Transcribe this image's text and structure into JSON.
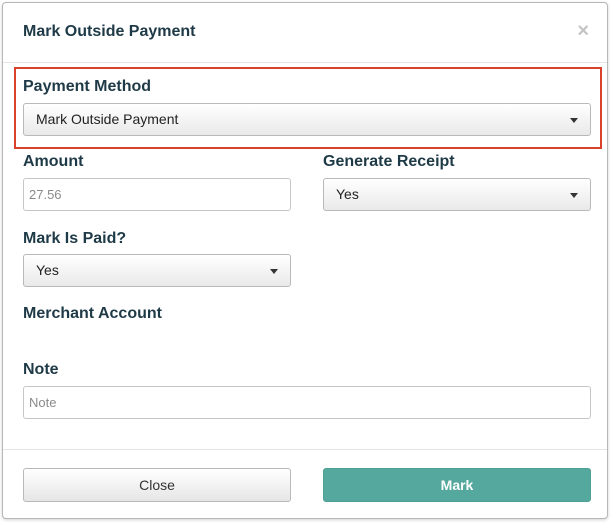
{
  "modal": {
    "title": "Mark Outside Payment",
    "close_icon": "×"
  },
  "payment_method": {
    "label": "Payment Method",
    "selected": "Mark Outside Payment"
  },
  "amount": {
    "label": "Amount",
    "value": "27.56"
  },
  "generate_receipt": {
    "label": "Generate Receipt",
    "selected": "Yes"
  },
  "mark_is_paid": {
    "label": "Mark Is Paid?",
    "selected": "Yes"
  },
  "merchant_account": {
    "label": "Merchant Account"
  },
  "note": {
    "label": "Note",
    "placeholder": "Note"
  },
  "footer": {
    "close_label": "Close",
    "mark_label": "Mark"
  },
  "colors": {
    "highlight": "#d9432b",
    "primary_button": "#55a89d",
    "label_text": "#1f3a47"
  },
  "icons": {
    "dismiss": "close-icon",
    "dropdown": "caret-down-icon"
  }
}
